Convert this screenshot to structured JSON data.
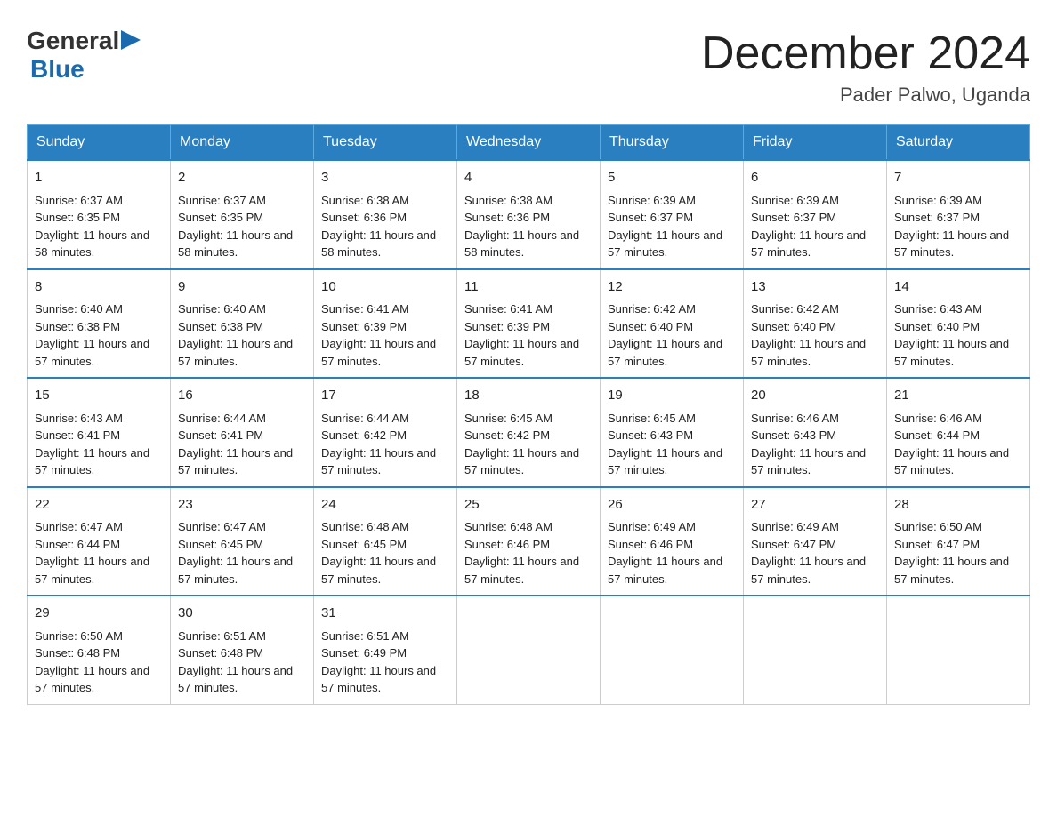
{
  "logo": {
    "text_general": "General",
    "text_blue": "Blue",
    "arrow": "▶"
  },
  "title": "December 2024",
  "location": "Pader Palwo, Uganda",
  "days_of_week": [
    "Sunday",
    "Monday",
    "Tuesday",
    "Wednesday",
    "Thursday",
    "Friday",
    "Saturday"
  ],
  "weeks": [
    [
      {
        "day": "1",
        "sunrise": "6:37 AM",
        "sunset": "6:35 PM",
        "daylight": "11 hours and 58 minutes."
      },
      {
        "day": "2",
        "sunrise": "6:37 AM",
        "sunset": "6:35 PM",
        "daylight": "11 hours and 58 minutes."
      },
      {
        "day": "3",
        "sunrise": "6:38 AM",
        "sunset": "6:36 PM",
        "daylight": "11 hours and 58 minutes."
      },
      {
        "day": "4",
        "sunrise": "6:38 AM",
        "sunset": "6:36 PM",
        "daylight": "11 hours and 58 minutes."
      },
      {
        "day": "5",
        "sunrise": "6:39 AM",
        "sunset": "6:37 PM",
        "daylight": "11 hours and 57 minutes."
      },
      {
        "day": "6",
        "sunrise": "6:39 AM",
        "sunset": "6:37 PM",
        "daylight": "11 hours and 57 minutes."
      },
      {
        "day": "7",
        "sunrise": "6:39 AM",
        "sunset": "6:37 PM",
        "daylight": "11 hours and 57 minutes."
      }
    ],
    [
      {
        "day": "8",
        "sunrise": "6:40 AM",
        "sunset": "6:38 PM",
        "daylight": "11 hours and 57 minutes."
      },
      {
        "day": "9",
        "sunrise": "6:40 AM",
        "sunset": "6:38 PM",
        "daylight": "11 hours and 57 minutes."
      },
      {
        "day": "10",
        "sunrise": "6:41 AM",
        "sunset": "6:39 PM",
        "daylight": "11 hours and 57 minutes."
      },
      {
        "day": "11",
        "sunrise": "6:41 AM",
        "sunset": "6:39 PM",
        "daylight": "11 hours and 57 minutes."
      },
      {
        "day": "12",
        "sunrise": "6:42 AM",
        "sunset": "6:40 PM",
        "daylight": "11 hours and 57 minutes."
      },
      {
        "day": "13",
        "sunrise": "6:42 AM",
        "sunset": "6:40 PM",
        "daylight": "11 hours and 57 minutes."
      },
      {
        "day": "14",
        "sunrise": "6:43 AM",
        "sunset": "6:40 PM",
        "daylight": "11 hours and 57 minutes."
      }
    ],
    [
      {
        "day": "15",
        "sunrise": "6:43 AM",
        "sunset": "6:41 PM",
        "daylight": "11 hours and 57 minutes."
      },
      {
        "day": "16",
        "sunrise": "6:44 AM",
        "sunset": "6:41 PM",
        "daylight": "11 hours and 57 minutes."
      },
      {
        "day": "17",
        "sunrise": "6:44 AM",
        "sunset": "6:42 PM",
        "daylight": "11 hours and 57 minutes."
      },
      {
        "day": "18",
        "sunrise": "6:45 AM",
        "sunset": "6:42 PM",
        "daylight": "11 hours and 57 minutes."
      },
      {
        "day": "19",
        "sunrise": "6:45 AM",
        "sunset": "6:43 PM",
        "daylight": "11 hours and 57 minutes."
      },
      {
        "day": "20",
        "sunrise": "6:46 AM",
        "sunset": "6:43 PM",
        "daylight": "11 hours and 57 minutes."
      },
      {
        "day": "21",
        "sunrise": "6:46 AM",
        "sunset": "6:44 PM",
        "daylight": "11 hours and 57 minutes."
      }
    ],
    [
      {
        "day": "22",
        "sunrise": "6:47 AM",
        "sunset": "6:44 PM",
        "daylight": "11 hours and 57 minutes."
      },
      {
        "day": "23",
        "sunrise": "6:47 AM",
        "sunset": "6:45 PM",
        "daylight": "11 hours and 57 minutes."
      },
      {
        "day": "24",
        "sunrise": "6:48 AM",
        "sunset": "6:45 PM",
        "daylight": "11 hours and 57 minutes."
      },
      {
        "day": "25",
        "sunrise": "6:48 AM",
        "sunset": "6:46 PM",
        "daylight": "11 hours and 57 minutes."
      },
      {
        "day": "26",
        "sunrise": "6:49 AM",
        "sunset": "6:46 PM",
        "daylight": "11 hours and 57 minutes."
      },
      {
        "day": "27",
        "sunrise": "6:49 AM",
        "sunset": "6:47 PM",
        "daylight": "11 hours and 57 minutes."
      },
      {
        "day": "28",
        "sunrise": "6:50 AM",
        "sunset": "6:47 PM",
        "daylight": "11 hours and 57 minutes."
      }
    ],
    [
      {
        "day": "29",
        "sunrise": "6:50 AM",
        "sunset": "6:48 PM",
        "daylight": "11 hours and 57 minutes."
      },
      {
        "day": "30",
        "sunrise": "6:51 AM",
        "sunset": "6:48 PM",
        "daylight": "11 hours and 57 minutes."
      },
      {
        "day": "31",
        "sunrise": "6:51 AM",
        "sunset": "6:49 PM",
        "daylight": "11 hours and 57 minutes."
      },
      null,
      null,
      null,
      null
    ]
  ]
}
